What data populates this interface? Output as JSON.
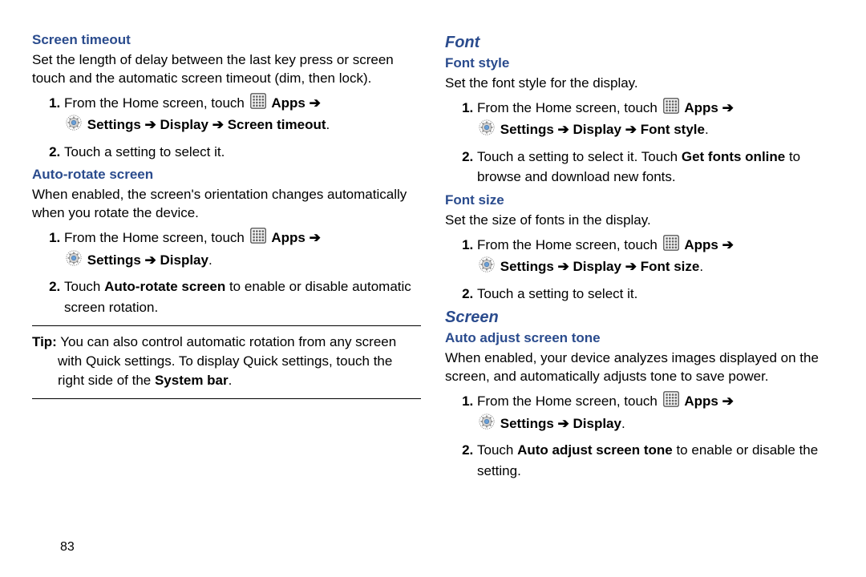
{
  "left": {
    "sec1": {
      "title": "Screen timeout",
      "desc": "Set the length of delay between the last key press or screen touch and the automatic screen timeout (dim, then lock).",
      "step1_a": "From the Home screen, touch ",
      "step1_apps": "Apps",
      "step1_settings": "Settings",
      "step1_path": "Display",
      "step1_leaf": "Screen timeout",
      "step2": "Touch a setting to select it."
    },
    "sec2": {
      "title": "Auto-rotate screen",
      "desc": "When enabled, the screen's orientation changes automatically when you rotate the device.",
      "step1_a": "From the Home screen, touch ",
      "step1_apps": "Apps",
      "step1_settings": "Settings",
      "step1_path": "Display",
      "step2_a": "Touch ",
      "step2_b": "Auto-rotate screen",
      "step2_c": " to enable or disable automatic screen rotation."
    },
    "tip": {
      "label": "Tip:",
      "l1": " You can also control automatic rotation from any screen",
      "l2": "with Quick settings. To display Quick settings, touch the",
      "l3": "right side of the ",
      "l3b": "System bar",
      "l3c": "."
    }
  },
  "right": {
    "font_h": "Font",
    "style": {
      "title": "Font style",
      "desc": "Set the font style for the display.",
      "step1_a": "From the Home screen, touch ",
      "step1_apps": "Apps",
      "step1_settings": "Settings",
      "step1_path": "Display",
      "step1_leaf": "Font style",
      "step2_a": "Touch a setting to select it. Touch ",
      "step2_b": "Get fonts online",
      "step2_c": " to browse and download new fonts."
    },
    "size": {
      "title": "Font size",
      "desc": "Set the size of fonts in the display.",
      "step1_a": "From the Home screen, touch ",
      "step1_apps": "Apps",
      "step1_settings": "Settings",
      "step1_path": "Display",
      "step1_leaf": "Font size",
      "step2": "Touch a setting to select it."
    },
    "screen_h": "Screen",
    "tone": {
      "title": "Auto adjust screen tone",
      "desc": "When enabled, your device analyzes images displayed on the screen, and automatically adjusts tone to save power.",
      "step1_a": "From the Home screen, touch ",
      "step1_apps": "Apps",
      "step1_settings": "Settings",
      "step1_path": "Display",
      "step2_a": "Touch ",
      "step2_b": "Auto adjust screen tone",
      "step2_c": " to enable or disable the setting."
    }
  },
  "page_number": "83",
  "arrow": " ➔ "
}
